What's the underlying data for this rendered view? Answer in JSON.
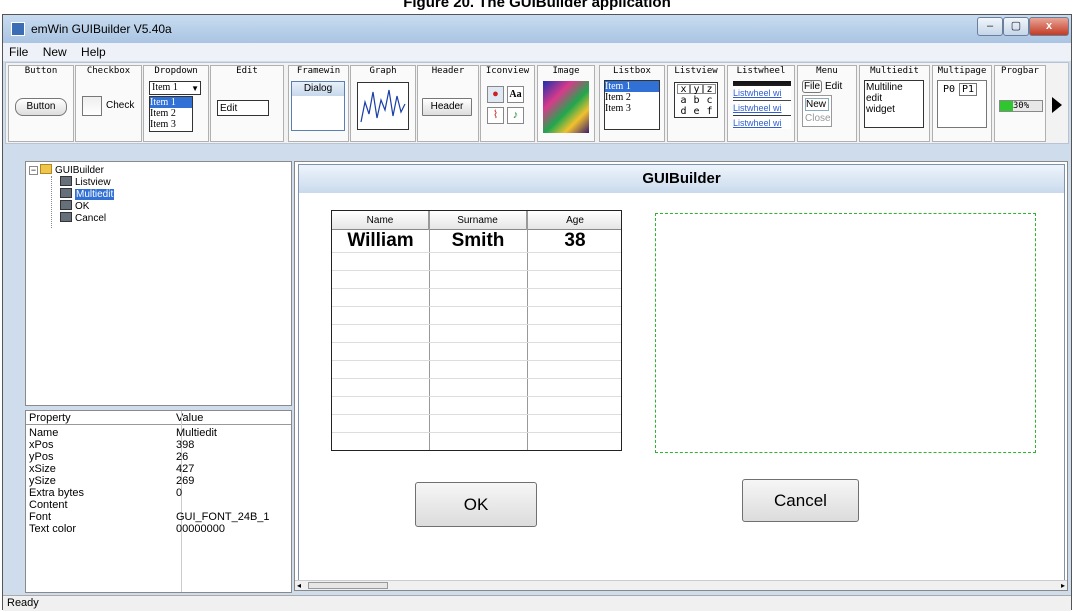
{
  "caption": "Figure 20. The GUIBuilder application",
  "window": {
    "title": "emWin GUIBuilder V5.40a",
    "min": "–",
    "max": "▢",
    "close": "x"
  },
  "menu": [
    "File",
    "New",
    "Help"
  ],
  "toolbar": {
    "labels": [
      "Button",
      "Checkbox",
      "Dropdown",
      "Edit",
      "Framewin",
      "Graph",
      "Header",
      "Iconview",
      "Image",
      "Listbox",
      "Listview",
      "Listwheel",
      "Menu",
      "Multiedit",
      "Multipage",
      "Progbar"
    ],
    "button_text": "Button",
    "checkbox_text": "Check",
    "dropdown_selected": "Item 1",
    "dropdown_items": [
      "Item 1",
      "Item 2",
      "Item 3"
    ],
    "edit_text": "Edit",
    "framewin_text": "Dialog",
    "header_text": "Header",
    "iconview_text": "Aa",
    "listbox_items": [
      "Item 1",
      "Item 2",
      "Item 3"
    ],
    "listview_cells": [
      "x",
      "y",
      "z",
      "a",
      "b",
      "c",
      "d",
      "e",
      "f"
    ],
    "listwheel_items": [
      "Listwheel wi",
      "Listwheel wi",
      "Listwheel wi"
    ],
    "menu_items": [
      "File",
      "Edit",
      "New",
      "Close"
    ],
    "multiedit_text": [
      "Multiline",
      "edit",
      "widget"
    ],
    "multipage_tabs": [
      "P0",
      "P1"
    ],
    "progbar_text": "30%",
    "progbar_value": 0.3
  },
  "tree": [
    {
      "label": "GUIBuilder",
      "icon": "folder-icon",
      "selected": false
    },
    {
      "label": "Listview",
      "icon": "widget-icon",
      "selected": false
    },
    {
      "label": "Multiedit",
      "icon": "widget-icon",
      "selected": true
    },
    {
      "label": "OK",
      "icon": "widget-icon",
      "selected": false
    },
    {
      "label": "Cancel",
      "icon": "widget-icon",
      "selected": false
    }
  ],
  "properties": {
    "header_key": "Property",
    "header_value": "Value",
    "rows": [
      [
        "Name",
        "Multiedit"
      ],
      [
        "xPos",
        "398"
      ],
      [
        "yPos",
        "26"
      ],
      [
        "xSize",
        "427"
      ],
      [
        "ySize",
        "269"
      ],
      [
        "Extra bytes",
        "0"
      ],
      [
        "Content",
        ""
      ],
      [
        "Font",
        "GUI_FONT_24B_1"
      ],
      [
        "Text color",
        "00000000"
      ]
    ]
  },
  "status": "Ready",
  "dialog": {
    "title": "GUIBuilder",
    "listview": {
      "columns": [
        "Name",
        "Surname",
        "Age"
      ],
      "rows": [
        [
          "William",
          "Smith",
          "38"
        ]
      ]
    },
    "ok": "OK",
    "cancel": "Cancel"
  }
}
